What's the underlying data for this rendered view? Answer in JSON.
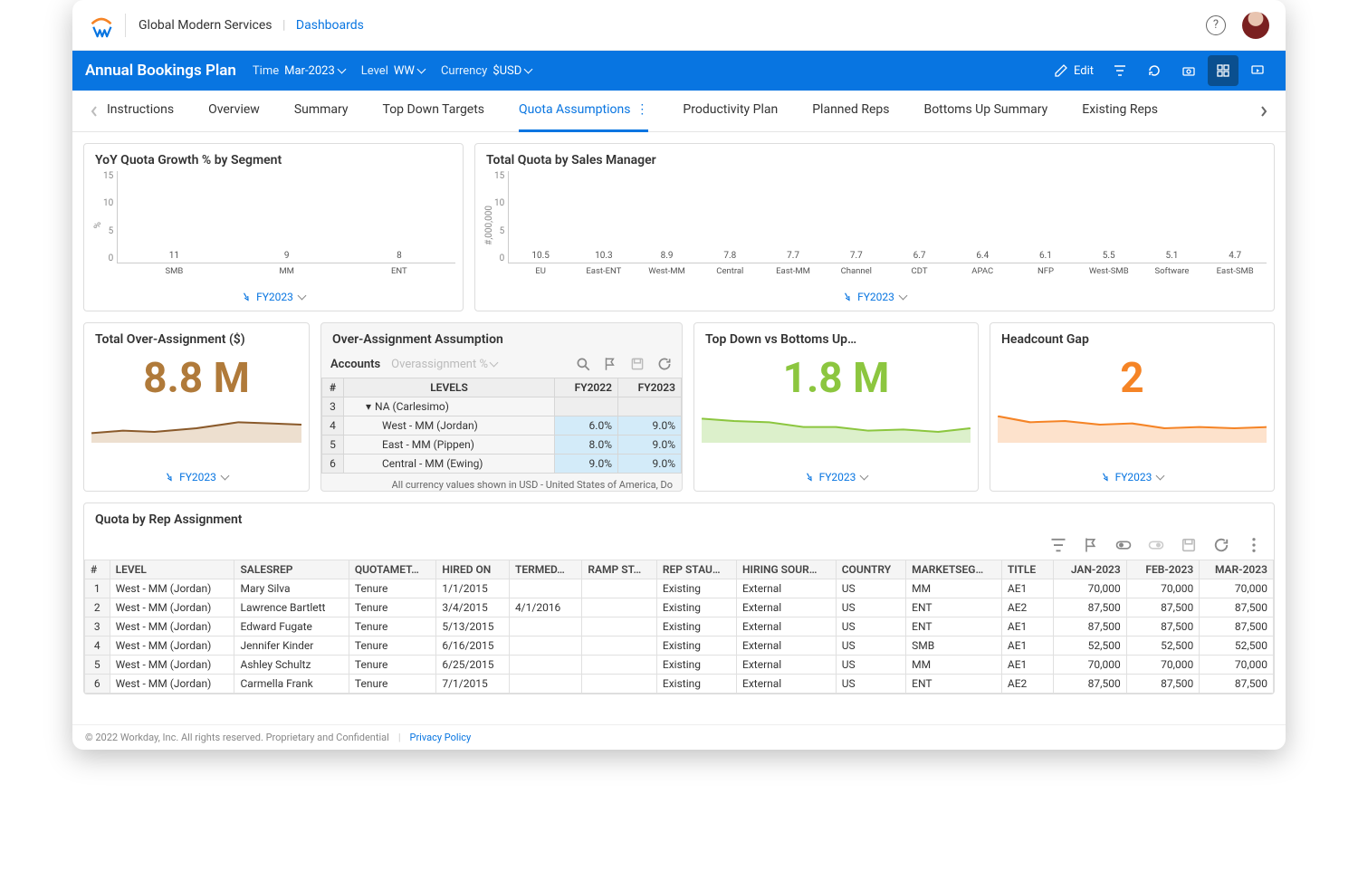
{
  "header": {
    "org": "Global Modern Services",
    "crumb_link": "Dashboards"
  },
  "bluebar": {
    "title": "Annual Bookings Plan",
    "selectors": [
      {
        "label": "Time",
        "value": "Mar-2023"
      },
      {
        "label": "Level",
        "value": "WW"
      },
      {
        "label": "Currency",
        "value": "$USD"
      }
    ],
    "edit_label": "Edit"
  },
  "tabs": [
    "Instructions",
    "Overview",
    "Summary",
    "Top Down Targets",
    "Quota Assumptions",
    "Productivity Plan",
    "Planned Reps",
    "Bottoms Up Summary",
    "Existing Reps"
  ],
  "active_tab": "Quota Assumptions",
  "card_yoy": {
    "title": "YoY Quota Growth % by Segment",
    "ylabel": "%",
    "footer_period": "FY2023"
  },
  "card_mgr": {
    "title": "Total Quota by Sales Manager",
    "ylabel": "#,000,000",
    "footer_period": "FY2023"
  },
  "card_over_total": {
    "title": "Total Over-Assignment ($)",
    "kpi": "8.8 M",
    "footer_period": "FY2023",
    "kpi_color": "#8a5a2b"
  },
  "card_over_assump": {
    "title": "Over-Assignment Assumption",
    "accounts_label": "Accounts",
    "ghost": "Overassignment %",
    "headers": [
      "#",
      "LEVELS",
      "FY2022",
      "FY2023"
    ],
    "rows": [
      {
        "n": "3",
        "level": "NA (Carlesimo)",
        "fy22": "",
        "fy23": "",
        "indent": 1,
        "expand": true
      },
      {
        "n": "4",
        "level": "West - MM (Jordan)",
        "fy22": "6.0%",
        "fy23": "9.0%",
        "indent": 2
      },
      {
        "n": "5",
        "level": "East - MM (Pippen)",
        "fy22": "8.0%",
        "fy23": "9.0%",
        "indent": 2
      },
      {
        "n": "6",
        "level": "Central - MM (Ewing)",
        "fy22": "9.0%",
        "fy23": "9.0%",
        "indent": 2
      }
    ],
    "footnote": "All currency values shown in USD - United States of America, Do"
  },
  "card_topdown": {
    "title": "Top Down vs Bottoms Up…",
    "kpi": "1.8 M",
    "footer_period": "FY2023",
    "kpi_color": "#8cc63f"
  },
  "card_headgap": {
    "title": "Headcount Gap",
    "kpi": "2",
    "footer_period": "FY2023",
    "kpi_color": "#f58426"
  },
  "card_quota_rep": {
    "title": "Quota by Rep Assignment",
    "headers": [
      "#",
      "LEVEL",
      "SALESREP",
      "QUOTAMET…",
      "HIRED ON",
      "TERMED…",
      "RAMP ST…",
      "REP STAU…",
      "HIRING SOUR…",
      "COUNTRY",
      "MARKETSEG…",
      "TITLE",
      "JAN-2023",
      "FEB-2023",
      "MAR-2023"
    ],
    "rows": [
      [
        "1",
        "West - MM (Jordan)",
        "Mary Silva",
        "Tenure",
        "1/1/2015",
        "",
        "",
        "Existing",
        "External",
        "US",
        "MM",
        "AE1",
        "70,000",
        "70,000",
        "70,000"
      ],
      [
        "2",
        "West - MM (Jordan)",
        "Lawrence Bartlett",
        "Tenure",
        "3/4/2015",
        "4/1/2016",
        "",
        "Existing",
        "External",
        "US",
        "ENT",
        "AE2",
        "87,500",
        "87,500",
        "87,500"
      ],
      [
        "3",
        "West - MM (Jordan)",
        "Edward Fugate",
        "Tenure",
        "5/13/2015",
        "",
        "",
        "Existing",
        "External",
        "US",
        "ENT",
        "AE1",
        "87,500",
        "87,500",
        "87,500"
      ],
      [
        "4",
        "West - MM (Jordan)",
        "Jennifer Kinder",
        "Tenure",
        "6/16/2015",
        "",
        "",
        "Existing",
        "External",
        "US",
        "SMB",
        "AE1",
        "52,500",
        "52,500",
        "52,500"
      ],
      [
        "5",
        "West - MM (Jordan)",
        "Ashley Schultz",
        "Tenure",
        "6/25/2015",
        "",
        "",
        "Existing",
        "External",
        "US",
        "MM",
        "AE1",
        "70,000",
        "70,000",
        "70,000"
      ],
      [
        "6",
        "West - MM (Jordan)",
        "Carmella Frank",
        "Tenure",
        "7/1/2015",
        "",
        "",
        "Existing",
        "External",
        "US",
        "ENT",
        "AE2",
        "87,500",
        "87,500",
        "87,500"
      ]
    ]
  },
  "footer": {
    "copyright": "© 2022 Workday, Inc. All rights reserved. Proprietary and Confidential",
    "privacy": "Privacy Policy"
  },
  "chart_data": [
    {
      "id": "yoy",
      "type": "bar",
      "title": "YoY Quota Growth % by Segment",
      "ylabel": "%",
      "ylim": [
        0,
        15
      ],
      "yticks": [
        0,
        5,
        10,
        15
      ],
      "categories": [
        "SMB",
        "MM",
        "ENT"
      ],
      "values": [
        11,
        9,
        8
      ],
      "color": "#2f5a1d"
    },
    {
      "id": "mgr",
      "type": "bar",
      "title": "Total Quota by Sales Manager",
      "ylabel": "#,000,000",
      "ylim": [
        0,
        15
      ],
      "yticks": [
        0,
        5,
        10,
        15
      ],
      "categories": [
        "EU",
        "East-ENT",
        "West-MM",
        "Central",
        "East-MM",
        "Channel",
        "CDT",
        "APAC",
        "NFP",
        "West-SMB",
        "Software",
        "East-SMB"
      ],
      "values": [
        10.5,
        10.3,
        8.9,
        7.8,
        7.7,
        7.7,
        6.7,
        6.4,
        6.1,
        5.5,
        5.1,
        4.7
      ],
      "color": "#74b34c"
    }
  ]
}
